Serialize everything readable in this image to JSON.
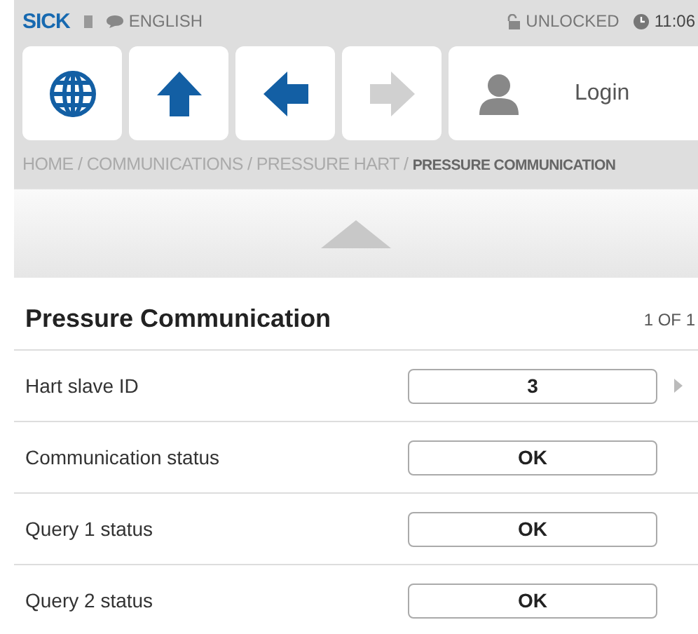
{
  "top_bar": {
    "logo": "SICK",
    "language": "ENGLISH",
    "lock_status": "UNLOCKED",
    "time": "11:06"
  },
  "nav_buttons": [
    {
      "kind": "globe",
      "disabled": false
    },
    {
      "kind": "up",
      "disabled": false
    },
    {
      "kind": "back",
      "disabled": false
    },
    {
      "kind": "forward",
      "disabled": true
    }
  ],
  "login": {
    "label": "Login"
  },
  "breadcrumb": "HOME / COMMUNICATIONS / PRESSURE HART / **PRESSURE COMMUNICATION**",
  "page": {
    "title": "Pressure Communication",
    "pager": "1 OF 1"
  },
  "rows": [
    {
      "label": "Hart slave ID",
      "value": "3",
      "has_arrow": true
    },
    {
      "label": "Communication status",
      "value": "OK",
      "has_arrow": false
    },
    {
      "label": "Query 1 status",
      "value": "OK",
      "has_arrow": false
    },
    {
      "label": "Query 2 status",
      "value": "OK",
      "has_arrow": false
    }
  ]
}
